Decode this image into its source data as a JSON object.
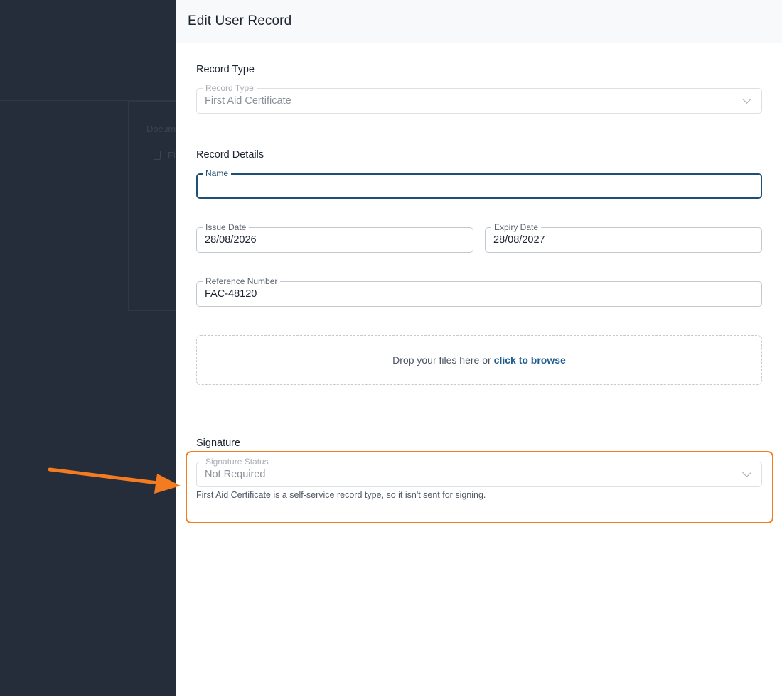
{
  "background": {
    "documents_label": "Documents",
    "first_item": "First Aid Certificate"
  },
  "drawer": {
    "title": "Edit User Record"
  },
  "record_type": {
    "section_title": "Record Type",
    "field_label": "Record Type",
    "value": "First Aid Certificate"
  },
  "record_details": {
    "section_title": "Record Details",
    "name": {
      "label": "Name",
      "value": ""
    },
    "issue_date": {
      "label": "Issue Date",
      "value": "28/08/2026"
    },
    "expiry_date": {
      "label": "Expiry Date",
      "value": "28/08/2027"
    },
    "reference_number": {
      "label": "Reference Number",
      "value": "FAC-48120"
    }
  },
  "upload": {
    "prompt": "Drop your files here or",
    "link": "click to browse"
  },
  "signature": {
    "section_title": "Signature",
    "status_label": "Signature Status",
    "status_value": "Not Required",
    "helper_text": "First Aid Certificate is a self-service record type, so it isn't sent for signing."
  },
  "annotation": {
    "highlight_color": "#f47b20"
  }
}
